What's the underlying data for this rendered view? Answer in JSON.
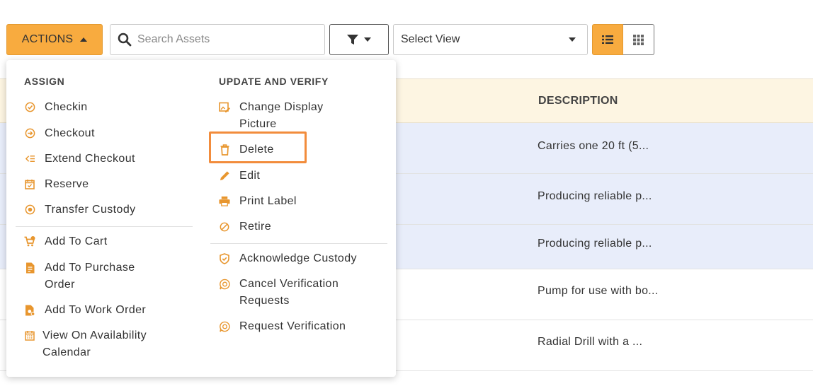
{
  "toolbar": {
    "actions_label": "ACTIONS",
    "search_placeholder": "Search Assets",
    "select_view_label": "Select View"
  },
  "table": {
    "header_description": "DESCRIPTION",
    "rows": [
      {
        "description": "Carries one 20 ft (5...",
        "selected": true
      },
      {
        "description": "Producing reliable p...",
        "selected": true
      },
      {
        "description": "Producing reliable p...",
        "selected": true
      },
      {
        "description": "Pump for use with bo...",
        "selected": false
      },
      {
        "description": "Radial Drill with a ...",
        "selected": false
      }
    ]
  },
  "menu": {
    "assign_title": "ASSIGN",
    "assign_items": [
      {
        "label": "Checkin",
        "icon": "check-circle-icon"
      },
      {
        "label": "Checkout",
        "icon": "arrow-circle-icon"
      },
      {
        "label": "Extend Checkout",
        "icon": "extend-list-icon"
      },
      {
        "label": "Reserve",
        "icon": "calendar-check-icon"
      },
      {
        "label": "Transfer Custody",
        "icon": "transfer-icon"
      }
    ],
    "assign_items_2": [
      {
        "label": "Add To Cart",
        "icon": "cart-plus-icon"
      },
      {
        "label": "Add To Purchase Order",
        "icon": "purchase-order-icon"
      },
      {
        "label": "Add To Work Order",
        "icon": "work-order-icon"
      },
      {
        "label": "View On Availability Calendar",
        "icon": "calendar-grid-icon"
      }
    ],
    "update_title": "UPDATE AND VERIFY",
    "update_items": [
      {
        "label": "Change Display Picture",
        "icon": "picture-edit-icon"
      },
      {
        "label": "Delete",
        "icon": "trash-icon"
      },
      {
        "label": "Edit",
        "icon": "pencil-icon"
      },
      {
        "label": "Print Label",
        "icon": "printer-icon"
      },
      {
        "label": "Retire",
        "icon": "ban-icon"
      }
    ],
    "update_items_2": [
      {
        "label": "Acknowledge Custody",
        "icon": "shield-check-icon"
      },
      {
        "label": "Cancel Verification Requests",
        "icon": "verify-cancel-icon"
      },
      {
        "label": "Request Verification",
        "icon": "verify-request-icon"
      }
    ]
  },
  "colors": {
    "accent": "#f8ab3f",
    "icon": "#e8962e",
    "highlight": "#f28c3c",
    "selected_row": "#e8edfa",
    "header_bg": "#fdf5e2"
  }
}
